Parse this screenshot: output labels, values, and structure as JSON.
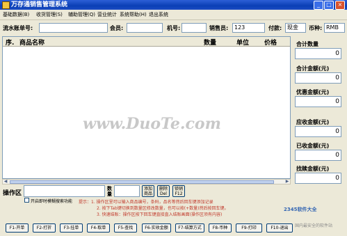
{
  "window": {
    "title": "万存通销售管理系统",
    "minimize": "_",
    "maximize": "□",
    "close": "×"
  },
  "menu": [
    "基础数据(B)",
    "收货管理(S)",
    "辅助管理(Q)",
    "营业统计",
    "系统帮助(H)",
    "退出系统"
  ],
  "form": {
    "serial_label": "流水账单号:",
    "serial_value": "",
    "member_label": "会员:",
    "member_value": "",
    "machine_label": "机号:",
    "machine_value": "",
    "salesperson_label": "销售员:",
    "salesperson_value": "123",
    "payment_label": "付款:",
    "payment_value": "现金",
    "currency_label": "币种:",
    "currency_value": "RMB"
  },
  "grid": {
    "columns": [
      "序.",
      "商品名称",
      "数量",
      "单位",
      "价格"
    ],
    "rows": []
  },
  "watermark": "www.DuoTe.com",
  "summary": [
    {
      "label": "合计数量",
      "value": "0"
    },
    {
      "label": "合计金额(元)",
      "value": "0"
    },
    {
      "label": "优惠金额(元)",
      "value": "0"
    },
    {
      "label": "应收金额(元)",
      "value": "0"
    },
    {
      "label": "已收金额(元)",
      "value": "0"
    },
    {
      "label": "找赎金额(元)",
      "value": "0"
    }
  ],
  "operation": {
    "label": "操作区",
    "input": "",
    "qty_label": "数量",
    "qty_value": "",
    "add_btn": "添加商品",
    "delete_btn": "删除Del",
    "lock_btn": "锁销F12",
    "checkbox_label": "开启即时模糊搜索功能"
  },
  "tips": [
    "提示：1. 操作区里可以输入商品编号，条码，品名等然后回车键添加记录",
    "2. 按下Tab键切换到数量区修改数量，也可以按(+数量)然后按回车键。",
    "3. 快速结账：操作区按下回车键直接直入结账画面(操作区须有内容)"
  ],
  "logo": "2345软件大全",
  "function_keys": [
    "F1-开单",
    "F2-打折",
    "F3-挂单",
    "F4-取单",
    "F5-查找",
    "F6-实收金额",
    "F7-结算方式",
    "F8-币种",
    "F9-打印",
    "F10-退出"
  ],
  "footer_watermark": "国内最安全的软件站"
}
